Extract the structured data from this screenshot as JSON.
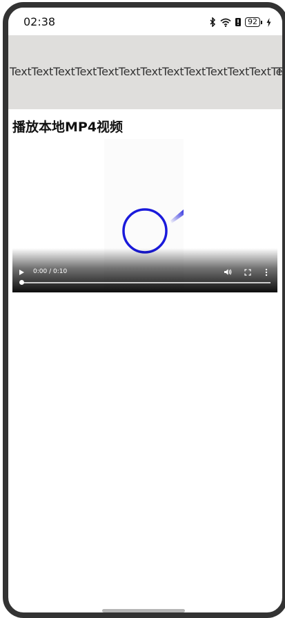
{
  "status_bar": {
    "time": "02:38",
    "battery_level": "92",
    "icons": [
      "bluetooth-icon",
      "wifi-icon",
      "alert-icon",
      "battery-icon",
      "charging-icon"
    ]
  },
  "marquee": {
    "text": "TextTextTextTextTextTextTextTextTextTextTextTextText",
    "tail_text": "T",
    "background": "#dfdedc"
  },
  "section": {
    "title": "播放本地MP4视频"
  },
  "video": {
    "time": "0:00 / 0:10",
    "progress": 0,
    "icons": [
      "play-icon",
      "volume-icon",
      "fullscreen-icon",
      "more-vert-icon"
    ],
    "accent_color": "#1a1adb"
  }
}
